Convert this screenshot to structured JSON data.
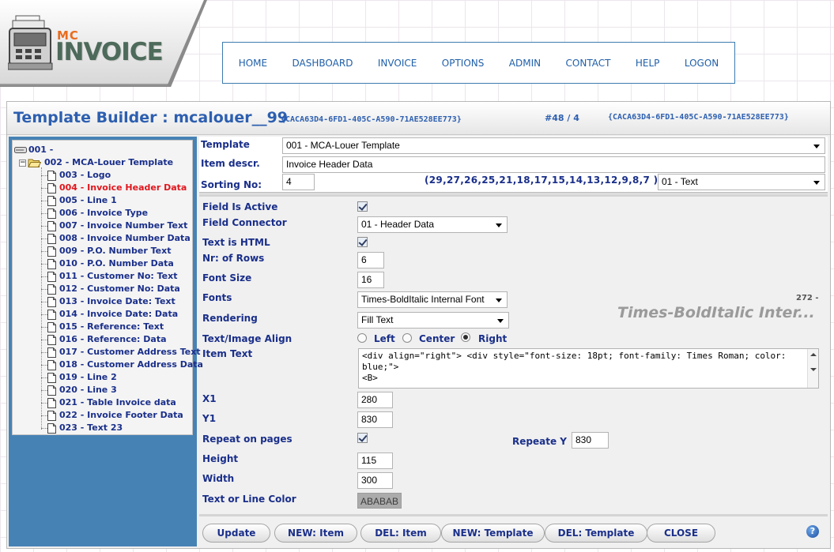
{
  "logo": {
    "mc": "MC",
    "invoice": "INVOICE"
  },
  "nav": [
    "HOME",
    "DASHBOARD",
    "INVOICE",
    "OPTIONS",
    "ADMIN",
    "CONTACT",
    "HELP",
    "LOGON"
  ],
  "header": {
    "title": "Template Builder : mcalouer__99",
    "guid_small": "{CACA63D4-6FD1-405C-A590-71AE528EE773}",
    "counter": "#48 / 4",
    "guid_right": "{CACA63D4-6FD1-405C-A590-71AE528EE773}"
  },
  "tree": {
    "root": "001 -",
    "parent": "002 - MCA-Louer Template",
    "selected_index": 1,
    "items": [
      "003 - Logo",
      "004 - Invoice Header Data",
      "005 - Line 1",
      "006 - Invoice Type",
      "007 - Invoice Number Text",
      "008 - Invoice Number Data",
      "009 - P.O. Number Text",
      "010 - P.O. Number Data",
      "011 - Customer No: Text",
      "012 - Customer No: Data",
      "013 - Invoice Date: Text",
      "014 - Invoice Date: Data",
      "015 - Reference: Text",
      "016 - Reference: Data",
      "017 - Customer Address Text",
      "018 - Customer Address Data",
      "019 - Line 2",
      "020 - Line 3",
      "021 - Table Invoice data",
      "022 - Invoice Footer Data",
      "023 - Text 23"
    ]
  },
  "top_form": {
    "template_label": "Template",
    "template_value": "001 - MCA-Louer Template",
    "descr_label": "Item descr.",
    "descr_value": "Invoice Header Data",
    "sorting_label": "Sorting No:",
    "sorting_value": "4",
    "sorting_list": "(29,27,26,25,21,18,17,15,14,13,12,9,8,7 )",
    "type_value": "01 - Text"
  },
  "form": {
    "active_label": "Field Is Active",
    "connector_label": "Field Connector",
    "connector_value": "01 - Header Data",
    "html_label": "Text is HTML",
    "rows_label": "Nr: of Rows",
    "rows_value": "6",
    "fontsize_label": "Font Size",
    "fontsize_value": "16",
    "fonts_label": "Fonts",
    "fonts_value": "Times-BoldItalic Internal Font",
    "preview_num": "272 -",
    "preview_text": "Times-BoldItalic Inter...",
    "rendering_label": "Rendering",
    "rendering_value": "Fill Text",
    "align_label": "Text/Image Align",
    "align_left": "Left",
    "align_center": "Center",
    "align_right": "Right",
    "itemtext_label": "Item Text",
    "itemtext_value": "<div align=\"right\"> <div style=\"font-size: 18pt; font-family: Times Roman; color: blue;\">\n<B>",
    "x1_label": "X1",
    "x1_value": "280",
    "y1_label": "Y1",
    "y1_value": "830",
    "repeat_label": "Repeat on pages",
    "repeatY_label": "Repeate Y",
    "repeatY_value": "830",
    "height_label": "Height",
    "height_value": "115",
    "width_label": "Width",
    "width_value": "300",
    "color_label": "Text or Line Color",
    "color_value": "ABABAB"
  },
  "buttons": [
    "Update",
    "NEW: Item",
    "DEL: Item",
    "NEW: Template",
    "DEL: Template",
    "CLOSE"
  ],
  "colors": {
    "accent_blue": "#1a2f8a",
    "title_blue": "#2d5fb0",
    "tree_bg": "#4682b4",
    "selected_red": "#e0161d",
    "swatch": "#ababab"
  }
}
